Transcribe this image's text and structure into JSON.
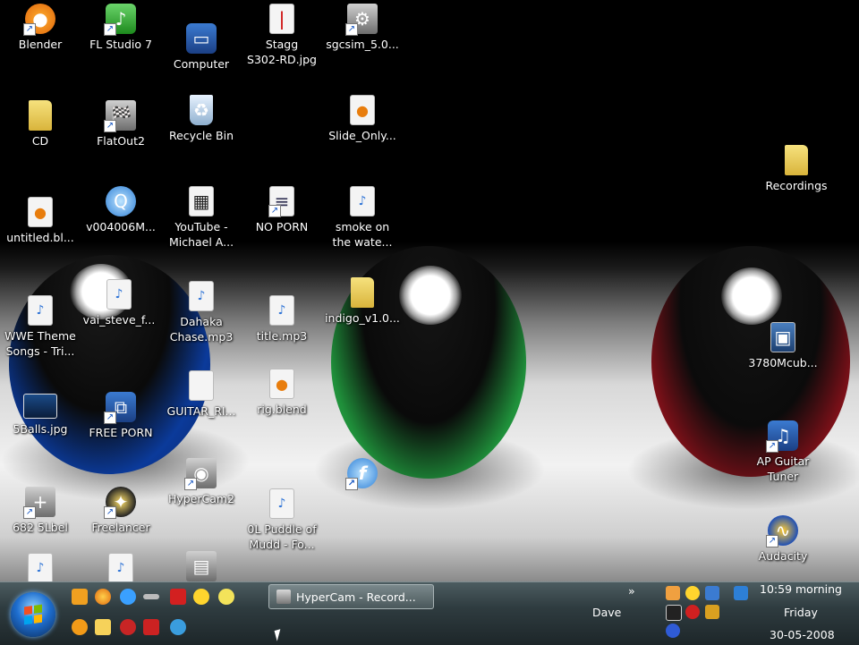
{
  "desktop": {
    "icons": [
      {
        "label": "Blender",
        "icon": "blender-app-icon"
      },
      {
        "label": "FL Studio 7",
        "icon": "fl-studio-icon"
      },
      {
        "label": "Computer",
        "icon": "computer-icon"
      },
      {
        "label": "Stagg\nS302-RD.jpg",
        "icon": "image-file-icon"
      },
      {
        "label": "sgcsim_5.0...",
        "icon": "installer-icon"
      },
      {
        "label": "CD",
        "icon": "folder-icon"
      },
      {
        "label": "FlatOut2",
        "icon": "game-icon"
      },
      {
        "label": "Recycle Bin",
        "icon": "recycle-bin-icon"
      },
      {
        "label": "Slide_Only...",
        "icon": "blend-file-icon"
      },
      {
        "label": "Recordings",
        "icon": "folder-icon"
      },
      {
        "label": "untitled.bl...",
        "icon": "blend-file-icon"
      },
      {
        "label": "v004006M...",
        "icon": "quicktime-icon"
      },
      {
        "label": "YouTube -\nMichael A...",
        "icon": "video-file-icon"
      },
      {
        "label": "NO PORN",
        "icon": "document-icon"
      },
      {
        "label": "smoke on\nthe wate...",
        "icon": "mp3-file-icon"
      },
      {
        "label": "vai_steve_f...",
        "icon": "mp3-file-icon"
      },
      {
        "label": "WWE Theme\nSongs - Tri...",
        "icon": "mp3-file-icon"
      },
      {
        "label": "Dahaka\nChase.mp3",
        "icon": "mp3-file-icon"
      },
      {
        "label": "title.mp3",
        "icon": "mp3-file-icon"
      },
      {
        "label": "indigo_v1.0...",
        "icon": "folder-icon"
      },
      {
        "label": "3780Mcub...",
        "icon": "image-file-icon"
      },
      {
        "label": "5Balls.jpg",
        "icon": "image-file-icon"
      },
      {
        "label": "FREE PORN",
        "icon": "network-icon"
      },
      {
        "label": "GUITAR_RI...",
        "icon": "blank-document-icon"
      },
      {
        "label": "rig.blend",
        "icon": "blend-file-icon"
      },
      {
        "label": "AP Guitar\nTuner",
        "icon": "tuner-app-icon"
      },
      {
        "label": "HyperCam2",
        "icon": "hypercam-icon"
      },
      {
        "label": "682 5Lbel",
        "icon": "installer-icon"
      },
      {
        "label": "Freelancer",
        "icon": "game-icon"
      },
      {
        "label": "0L Puddle of\nMudd - Fo...",
        "icon": "mp3-file-icon"
      },
      {
        "label": "Audacity",
        "icon": "audacity-icon"
      }
    ]
  },
  "taskbar": {
    "task_button_label": "HyperCam - Record...",
    "tray_overflow": "»",
    "user_label": "Dave",
    "clock_time": "10:59 morning",
    "clock_day": "Friday",
    "clock_date": "30-05-2008"
  },
  "colors": {
    "taskbar": "#2f3c40",
    "ball_blue": "#0b3a9a",
    "ball_green": "#2aa84a",
    "ball_red": "#9c1420"
  }
}
